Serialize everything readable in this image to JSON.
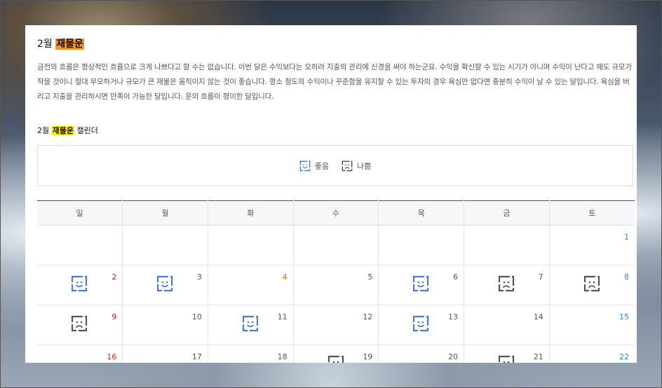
{
  "title": {
    "prefix": "2월",
    "highlight": "재물운"
  },
  "description": "금전의 흐름은 평상적인 흐름으로 크게 나쁘다고 할 수는 없습니다. 이번 달은 수익보다는 오히려 지출의 관리에 신경을 써야 하는군요. 수익을 확신할 수 있는 시기가 아니며 수익이 난다고 해도 규모가 작을 것이니 절대 무모하거나 규모가 큰 재물은 움직이지 않는 것이 좋습니다. 평소 정도의 수익이나 꾸준함을 유지할 수 있는 투자의 경우 욕심만 없다면 충분히 수익이 날 수 있는 달입니다. 욕심을 버리고 지출을 관리하시면 만족이 가능한 달입니다. 운의 흐름이 평이한 달입니다.",
  "calendar_title": {
    "prefix": "2월",
    "highlight": "재물운",
    "suffix": "캘린더"
  },
  "legend": {
    "good": "좋음",
    "bad": "나쁨"
  },
  "colors": {
    "good": "#4a78e0",
    "bad": "#555555",
    "sunday": "#e02020",
    "saturday": "#1f8fd6",
    "holiday": "#ff6600",
    "title_highlight": "#ff9424",
    "subtitle_highlight": "#fff200"
  },
  "weekdays": [
    "일",
    "월",
    "화",
    "수",
    "목",
    "금",
    "토"
  ],
  "weeks": [
    [
      {
        "day": ""
      },
      {
        "day": ""
      },
      {
        "day": ""
      },
      {
        "day": ""
      },
      {
        "day": ""
      },
      {
        "day": ""
      },
      {
        "day": "1"
      }
    ],
    [
      {
        "day": "2",
        "fortune": "good"
      },
      {
        "day": "3",
        "fortune": "good"
      },
      {
        "day": "4",
        "holiday": true
      },
      {
        "day": "5"
      },
      {
        "day": "6",
        "fortune": "good"
      },
      {
        "day": "7",
        "fortune": "bad"
      },
      {
        "day": "8",
        "fortune": "bad"
      }
    ],
    [
      {
        "day": "9",
        "fortune": "bad"
      },
      {
        "day": "10"
      },
      {
        "day": "11",
        "fortune": "good"
      },
      {
        "day": "12"
      },
      {
        "day": "13",
        "fortune": "good"
      },
      {
        "day": "14"
      },
      {
        "day": "15"
      }
    ],
    [
      {
        "day": "16"
      },
      {
        "day": "17"
      },
      {
        "day": "18"
      },
      {
        "day": "19",
        "fortune": "bad"
      },
      {
        "day": "20"
      },
      {
        "day": "21",
        "fortune": "bad"
      },
      {
        "day": "22"
      }
    ]
  ]
}
